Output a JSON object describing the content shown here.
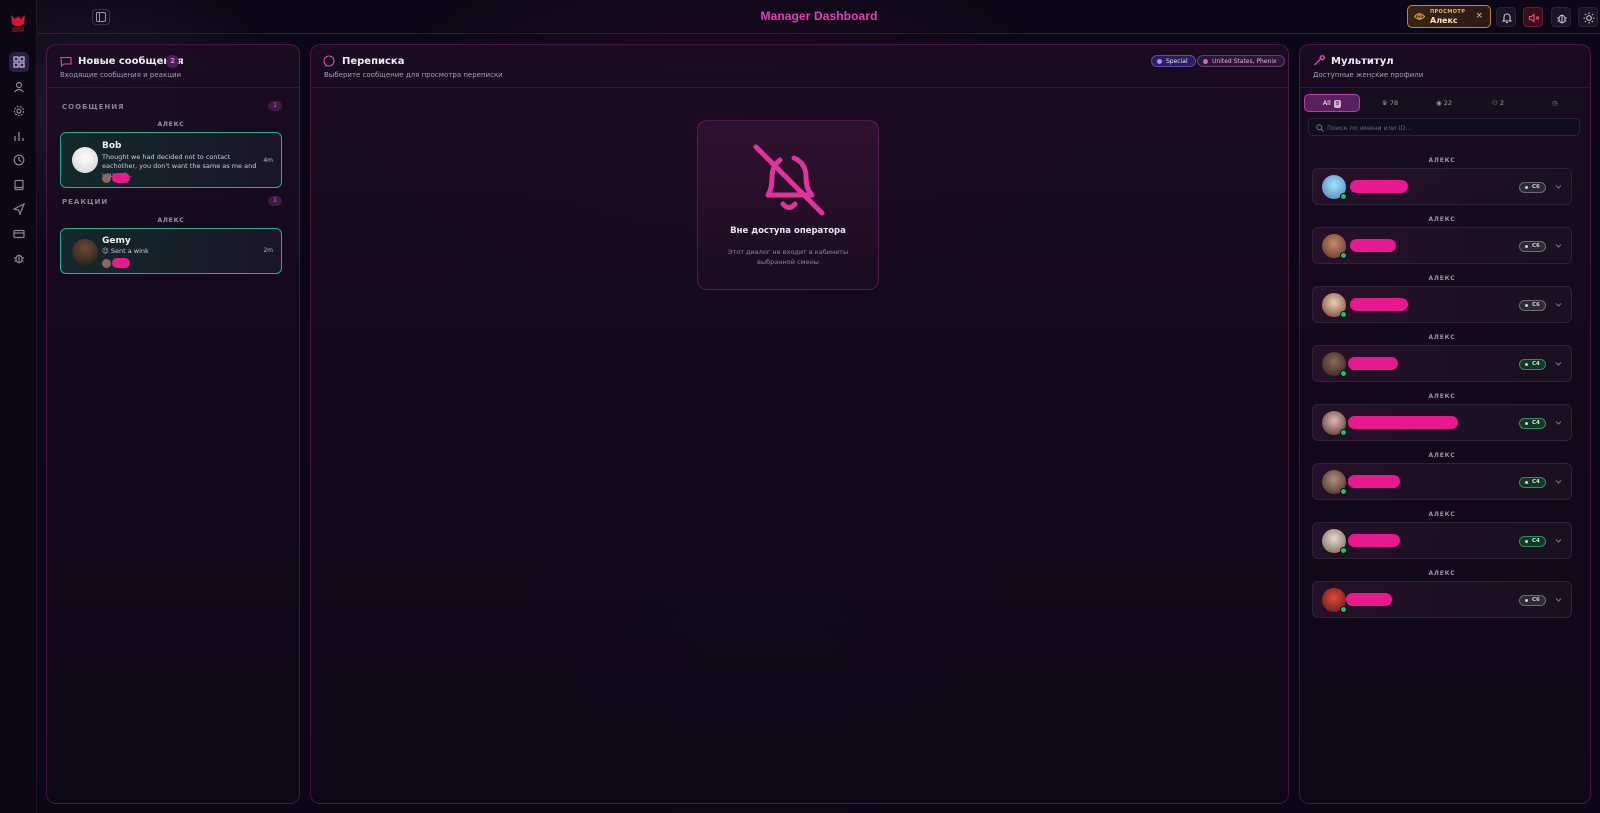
{
  "app": {
    "title": "Manager Dashboard",
    "colors": {
      "accent": "#e23fb8",
      "success": "#1fb190",
      "warning": "#c98520",
      "danger": "#6a1b30"
    }
  },
  "header": {
    "viewing": {
      "label": "ПРОСМОТР",
      "name": "Алекс",
      "close": "×"
    },
    "icons": [
      "panel-toggle-icon",
      "eye-icon",
      "bell-icon",
      "sound-off-icon",
      "bug-icon",
      "sun-icon",
      "logout-icon"
    ]
  },
  "rail": {
    "items": [
      "dashboard-icon",
      "user-icon",
      "settings-icon",
      "chart-icon",
      "clock-icon",
      "book-icon",
      "send-icon",
      "card-icon",
      "bug-icon"
    ]
  },
  "left_panel": {
    "title": "Новые сообщения",
    "count": "2",
    "subtitle": "Входящие сообщения и реакции",
    "sections": [
      {
        "label": "СООБЩЕНИЯ",
        "count": "1",
        "group": "АЛЕКС",
        "item": {
          "name": "Bob",
          "text": "Thought we had decided not to contact eachother, you don't want the same as me and you onl...",
          "time": "4m"
        }
      },
      {
        "label": "РЕАКЦИИ",
        "count": "1",
        "group": "АЛЕКС",
        "item": {
          "name": "Gemy",
          "text": "😉 Sent a wink",
          "time": "2m"
        }
      }
    ]
  },
  "center_panel": {
    "title": "Переписка",
    "subtitle": "Выберите сообщение для просмотра переписки",
    "chips": {
      "special": "Special",
      "location": "United States, Phenix"
    },
    "empty": {
      "title": "Вне доступа оператора",
      "text": "Этот диалог не входит в кабинеты выбранной смены"
    }
  },
  "right_panel": {
    "title": "Мультитул",
    "subtitle": "Доступные женские профили",
    "tabs": [
      {
        "label": "All",
        "count": "8"
      },
      {
        "label": "78"
      },
      {
        "label": "22"
      },
      {
        "label": "2"
      },
      {
        "label": ""
      }
    ],
    "search": {
      "placeholder": "Поиск по имени или ID..."
    },
    "profiles": [
      {
        "group": "АЛЕКС",
        "tag": "C6"
      },
      {
        "group": "АЛЕКС",
        "tag": "C6"
      },
      {
        "group": "АЛЕКС",
        "tag": "C6"
      },
      {
        "group": "АЛЕКС",
        "tag": "C4"
      },
      {
        "group": "АЛЕКС",
        "tag": "C4"
      },
      {
        "group": "АЛЕКС",
        "tag": "C4"
      },
      {
        "group": "АЛЕКС",
        "tag": "C4"
      },
      {
        "group": "АЛЕКС",
        "tag": "C6"
      }
    ]
  }
}
